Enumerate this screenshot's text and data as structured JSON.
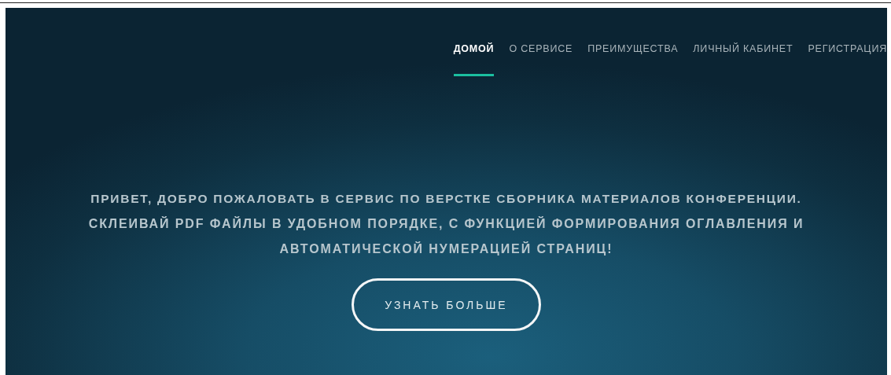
{
  "nav": [
    {
      "label": "ДОМОЙ",
      "selected": true
    },
    {
      "label": "О СЕРВИСЕ",
      "selected": false
    },
    {
      "label": "ПРЕИМУЩЕСТВА",
      "selected": false
    },
    {
      "label": "ЛИЧНЫЙ КАБИНЕТ",
      "selected": false
    },
    {
      "label": "РЕГИСТРАЦИЯ",
      "selected": false
    }
  ],
  "hero": {
    "title": "ПРИВЕТ, ДОБРО ПОЖАЛОВАТЬ В СЕРВИС ПО ВЕРСТКЕ СБОРНИКА МАТЕРИАЛОВ КОНФЕРЕНЦИИ.",
    "subtitle": "СКЛЕИВАЙ PDF ФАЙЛЫ В УДОБНОМ ПОРЯДКЕ, С ФУНКЦИЕЙ ФОРМИРОВАНИЯ ОГЛАВЛЕНИЯ И АВТОМАТИЧЕСКОЙ НУМЕРАЦИЕЙ СТРАНИЦ!",
    "button": "УЗНАТЬ БОЛЬШЕ"
  }
}
